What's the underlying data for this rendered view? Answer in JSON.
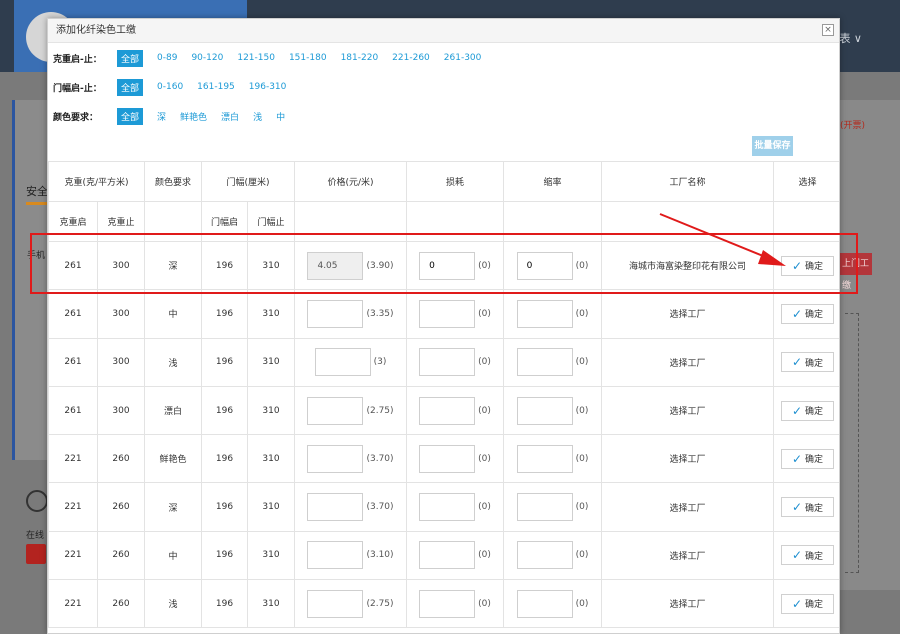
{
  "background": {
    "user_label": "表 ∨",
    "left_heading": "安全",
    "left_sub": "手机",
    "online_label": "在线",
    "right_red_text": "(开票)",
    "right_button_label": "上门工缴"
  },
  "modal": {
    "title": "添加化纤染色工缴",
    "close_symbol": "×",
    "batch_save_label": "批量保存"
  },
  "filters": [
    {
      "label": "克重启-止：",
      "options": [
        "全部",
        "0-89",
        "90-120",
        "121-150",
        "151-180",
        "181-220",
        "221-260",
        "261-300"
      ],
      "active": 0
    },
    {
      "label": "门幅启-止：",
      "options": [
        "全部",
        "0-160",
        "161-195",
        "196-310"
      ],
      "active": 0
    },
    {
      "label": "颜色要求：",
      "options": [
        "全部",
        "深",
        "鲜艳色",
        "漂白",
        "浅",
        "中"
      ],
      "active": 0
    }
  ],
  "table": {
    "headers_top": {
      "weight": "克重(克/平方米)",
      "color": "颜色要求",
      "width": "门幅(厘米)",
      "price": "价格(元/米)",
      "loss": "损耗",
      "shrink": "缩率",
      "factory": "工厂名称",
      "select": "选择"
    },
    "headers_sub": {
      "weight_start": "克重启",
      "weight_end": "克重止",
      "width_start": "门幅启",
      "width_end": "门幅止"
    },
    "confirm_label": "确定",
    "rows": [
      {
        "w1": "261",
        "w2": "300",
        "color": "深",
        "m1": "196",
        "m2": "310",
        "price": "4.05",
        "price_ref": "(3.90)",
        "loss": "0",
        "loss_ref": "(0)",
        "shrink": "0",
        "shrink_ref": "(0)",
        "factory": "海城市海富染整印花有限公司"
      },
      {
        "w1": "261",
        "w2": "300",
        "color": "中",
        "m1": "196",
        "m2": "310",
        "price": "",
        "price_ref": "(3.35)",
        "loss": "",
        "loss_ref": "(0)",
        "shrink": "",
        "shrink_ref": "(0)",
        "factory": "选择工厂"
      },
      {
        "w1": "261",
        "w2": "300",
        "color": "浅",
        "m1": "196",
        "m2": "310",
        "price": "",
        "price_ref": "(3)",
        "loss": "",
        "loss_ref": "(0)",
        "shrink": "",
        "shrink_ref": "(0)",
        "factory": "选择工厂"
      },
      {
        "w1": "261",
        "w2": "300",
        "color": "漂白",
        "m1": "196",
        "m2": "310",
        "price": "",
        "price_ref": "(2.75)",
        "loss": "",
        "loss_ref": "(0)",
        "shrink": "",
        "shrink_ref": "(0)",
        "factory": "选择工厂"
      },
      {
        "w1": "221",
        "w2": "260",
        "color": "鲜艳色",
        "m1": "196",
        "m2": "310",
        "price": "",
        "price_ref": "(3.70)",
        "loss": "",
        "loss_ref": "(0)",
        "shrink": "",
        "shrink_ref": "(0)",
        "factory": "选择工厂"
      },
      {
        "w1": "221",
        "w2": "260",
        "color": "深",
        "m1": "196",
        "m2": "310",
        "price": "",
        "price_ref": "(3.70)",
        "loss": "",
        "loss_ref": "(0)",
        "shrink": "",
        "shrink_ref": "(0)",
        "factory": "选择工厂"
      },
      {
        "w1": "221",
        "w2": "260",
        "color": "中",
        "m1": "196",
        "m2": "310",
        "price": "",
        "price_ref": "(3.10)",
        "loss": "",
        "loss_ref": "(0)",
        "shrink": "",
        "shrink_ref": "(0)",
        "factory": "选择工厂"
      },
      {
        "w1": "221",
        "w2": "260",
        "color": "浅",
        "m1": "196",
        "m2": "310",
        "price": "",
        "price_ref": "(2.75)",
        "loss": "",
        "loss_ref": "(0)",
        "shrink": "",
        "shrink_ref": "(0)",
        "factory": "选择工厂"
      }
    ]
  },
  "colors": {
    "accent": "#1d9ad6",
    "annotation": "#e01a1a",
    "header_bar": "#2f3d4e"
  }
}
